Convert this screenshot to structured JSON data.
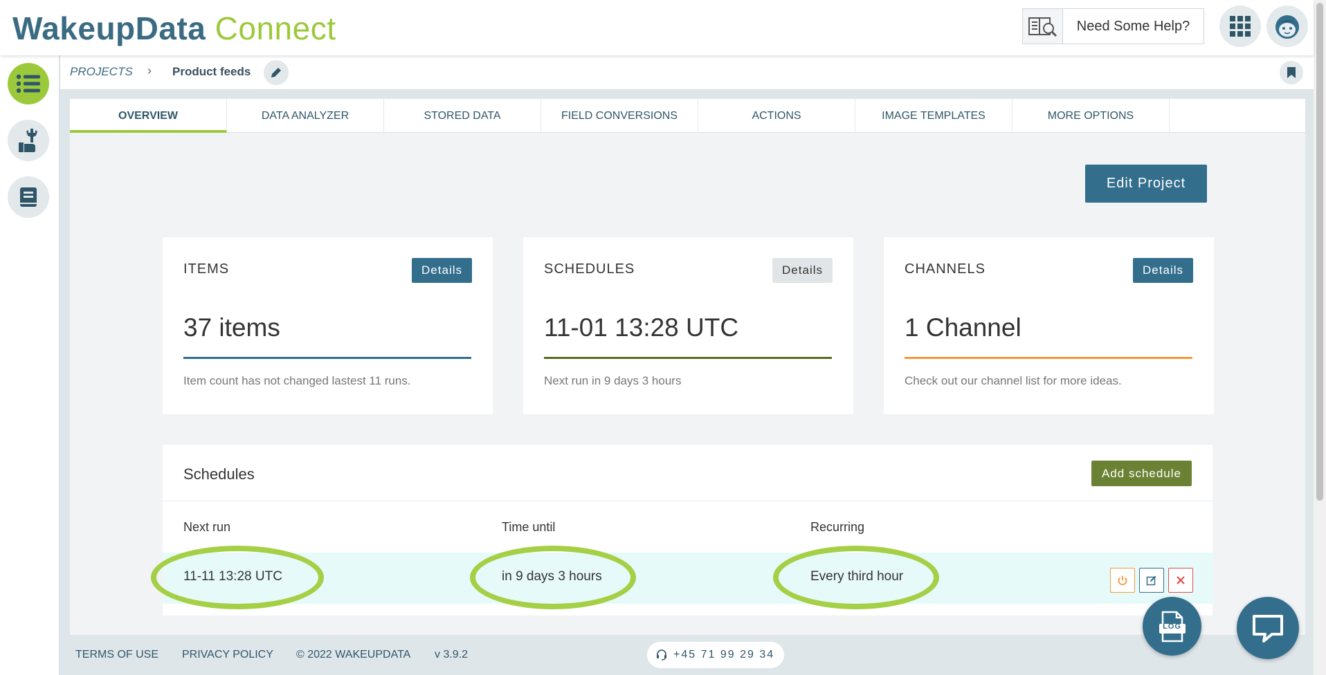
{
  "header": {
    "logo_part1": "WakeupData",
    "logo_part2": "Connect",
    "help_label": "Need Some Help?",
    "help_icon": "help-book-search-icon",
    "apps_icon": "grid-apps-icon",
    "avatar_icon": "avatar-face-icon"
  },
  "sidebar": {
    "items": [
      {
        "icon": "list-icon",
        "active": true
      },
      {
        "icon": "tools-hand-icon",
        "active": false
      },
      {
        "icon": "book-icon",
        "active": false
      }
    ]
  },
  "breadcrumb": {
    "root": "PROJECTS",
    "separator": "›",
    "current": "Product feeds"
  },
  "tabs": [
    {
      "label": "OVERVIEW",
      "active": true
    },
    {
      "label": "DATA ANALYZER",
      "active": false
    },
    {
      "label": "STORED DATA",
      "active": false
    },
    {
      "label": "FIELD CONVERSIONS",
      "active": false
    },
    {
      "label": "ACTIONS",
      "active": false
    },
    {
      "label": "IMAGE TEMPLATES",
      "active": false
    },
    {
      "label": "MORE OPTIONS",
      "active": false
    }
  ],
  "edit_project_label": "Edit Project",
  "cards": [
    {
      "title": "ITEMS",
      "button": "Details",
      "value": "37 items",
      "note": "Item count has not changed lastest 11 runs.",
      "line_color": "#336e8c"
    },
    {
      "title": "SCHEDULES",
      "button": "Details",
      "value": "11-01 13:28 UTC",
      "note": "Next run in 9 days 3 hours",
      "line_color": "#5a6b22"
    },
    {
      "title": "CHANNELS",
      "button": "Details",
      "value": "1 Channel",
      "note": "Check out our channel list for more ideas.",
      "line_color": "#f29a3a"
    }
  ],
  "schedules": {
    "title": "Schedules",
    "add_label": "Add schedule",
    "columns": [
      "Next run",
      "Time until",
      "Recurring"
    ],
    "rows": [
      {
        "next_run": "11-11 13:28 UTC",
        "time_until": "in 9 days 3 hours",
        "recurring": "Every third hour"
      }
    ],
    "highlight_color": "#a5cf45"
  },
  "footer": {
    "terms": "TERMS OF USE",
    "privacy": "PRIVACY POLICY",
    "copyright": "© 2022 WAKEUPDATA",
    "version": "v 3.9.2",
    "phone": "+45 71 99 29 34"
  },
  "fabs": {
    "log_label": "LOG",
    "chat_icon": "chat-bubble-icon"
  },
  "colors": {
    "brand_blue": "#336e8c",
    "brand_green": "#9cc93b",
    "olive": "#6b8234"
  }
}
